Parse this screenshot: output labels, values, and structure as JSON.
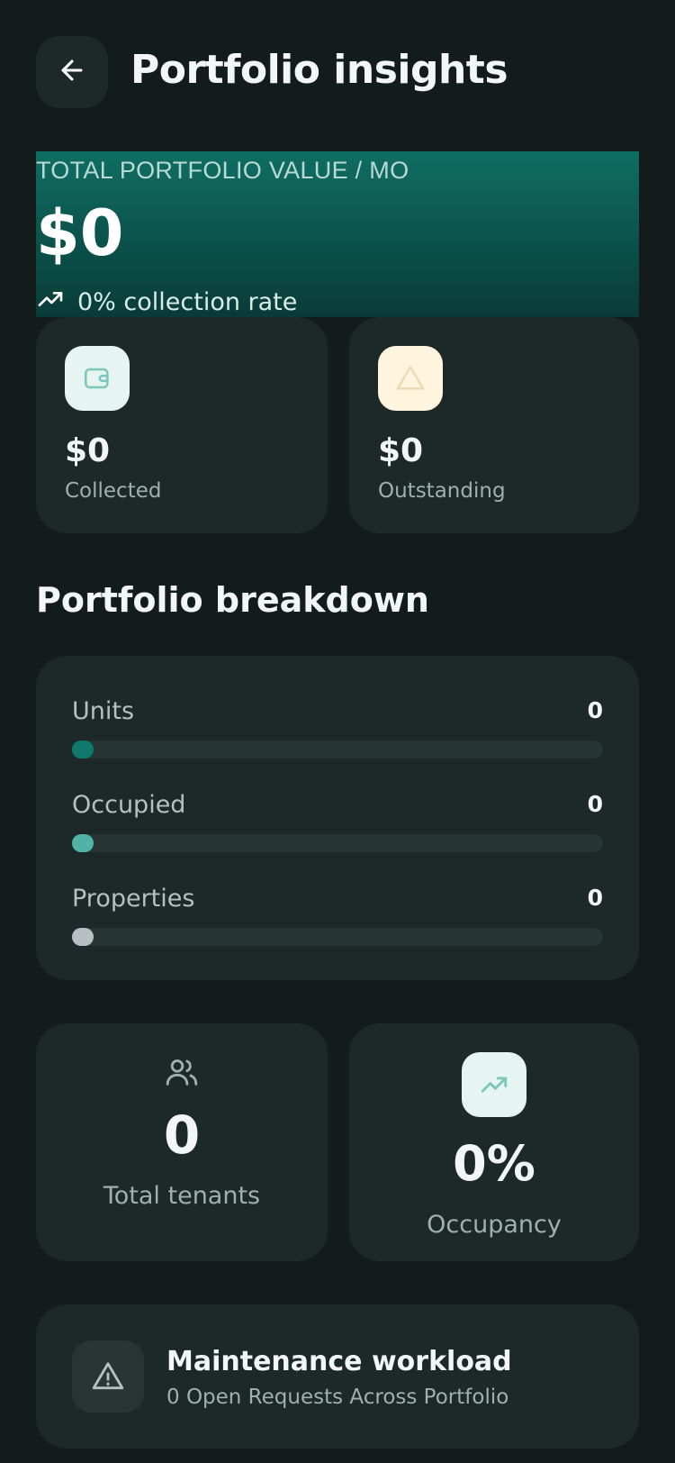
{
  "header": {
    "title": "Portfolio insights",
    "back_icon": "arrow-left-icon"
  },
  "hero": {
    "label": "TOTAL PORTFOLIO VALUE / MO",
    "value": "$0",
    "rate_text": "0% collection rate",
    "icon": "trending-up-icon"
  },
  "stats": {
    "collected": {
      "value": "$0",
      "label": "Collected",
      "icon": "wallet-icon",
      "icon_bg": "#e6f5f2",
      "icon_color": "#7cc7bc"
    },
    "outstanding": {
      "value": "$0",
      "label": "Outstanding",
      "icon": "warning-triangle-icon",
      "icon_bg": "#fff4de",
      "icon_color": "#f1dfb8"
    }
  },
  "breakdown": {
    "title": "Portfolio breakdown",
    "rows": [
      {
        "label": "Units",
        "value": "0",
        "fraction": 0,
        "color": "#0f7a6c"
      },
      {
        "label": "Occupied",
        "value": "0",
        "fraction": 0,
        "color": "#4fb3a6"
      },
      {
        "label": "Properties",
        "value": "0",
        "fraction": 0,
        "color": "#b7bfc4"
      }
    ]
  },
  "tenants": {
    "value": "0",
    "label": "Total tenants",
    "icon": "users-icon"
  },
  "occupancy": {
    "value": "0%",
    "label": "Occupancy",
    "icon": "trending-up-icon",
    "icon_bg": "#e6f5f2"
  },
  "maintenance": {
    "title": "Maintenance workload",
    "subtitle": "0 Open Requests Across Portfolio",
    "icon": "warning-triangle-icon"
  },
  "colors": {
    "background": "#141b1b",
    "card": "#1d2828",
    "accent": "#0f7a6c"
  }
}
